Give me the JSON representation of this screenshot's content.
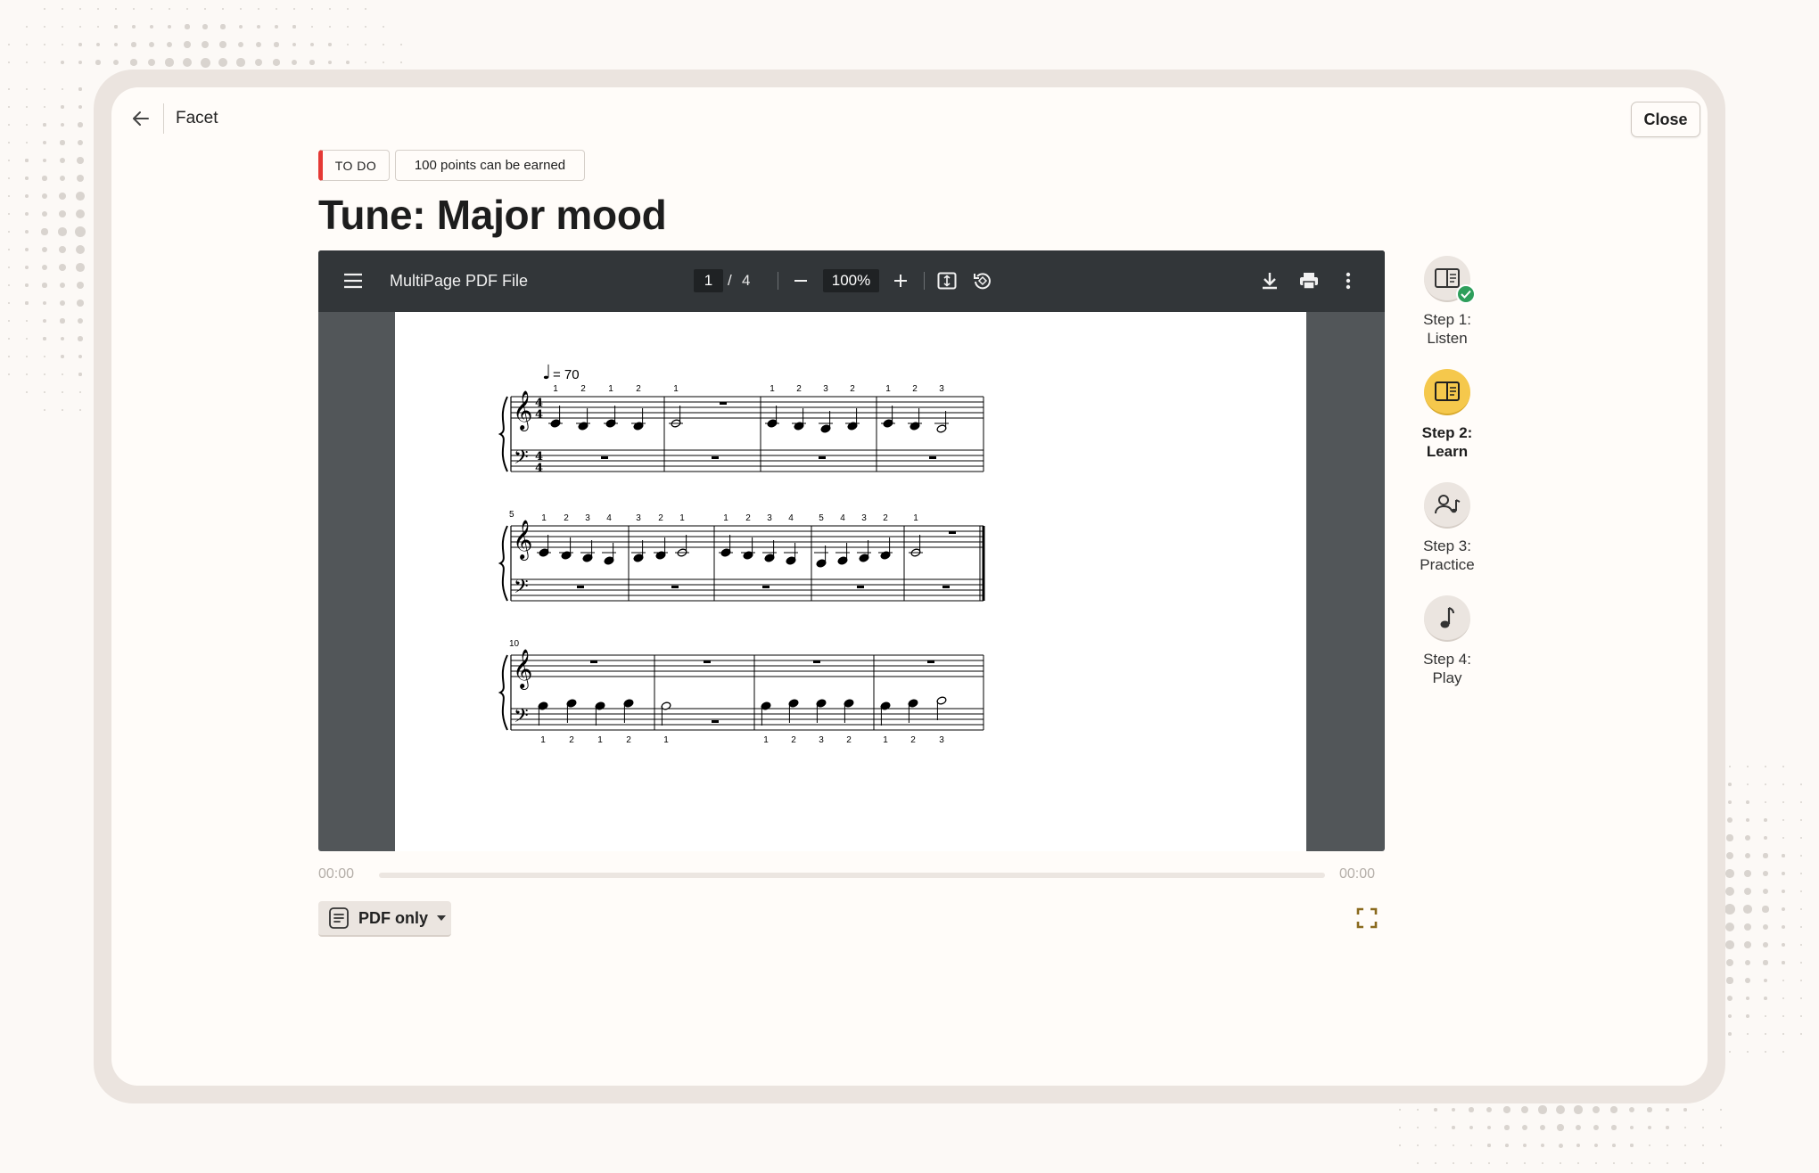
{
  "header": {
    "app_name": "Facet",
    "close_label": "Close"
  },
  "task": {
    "status_tag": "TO DO",
    "points_tag": "100 points can be earned",
    "title": "Tune: Major mood",
    "status_color": "#e53935"
  },
  "pdf_viewer": {
    "file_name": "MultiPage PDF File",
    "current_page": "1",
    "page_separator": "/",
    "total_pages": "4",
    "zoom": "100%",
    "icons": [
      "menu-icon",
      "zoom-out-icon",
      "zoom-in-icon",
      "fit-page-icon",
      "rotate-icon",
      "download-icon",
      "print-icon",
      "more-icon"
    ]
  },
  "sheet_music": {
    "tempo_value": "= 70",
    "systems": [
      {
        "measure_number": "",
        "treble_fingerings": [
          "1",
          "2",
          "1",
          "2",
          "1",
          "1",
          "2",
          "3",
          "2",
          "1",
          "2",
          "3"
        ],
        "bass_fingerings": []
      },
      {
        "measure_number": "5",
        "treble_fingerings": [
          "1",
          "2",
          "3",
          "4",
          "3",
          "2",
          "1",
          "1",
          "2",
          "3",
          "4",
          "5",
          "4",
          "3",
          "2",
          "1"
        ],
        "bass_fingerings": []
      },
      {
        "measure_number": "10",
        "treble_fingerings": [],
        "bass_fingerings": [
          "1",
          "2",
          "1",
          "2",
          "1",
          "1",
          "2",
          "3",
          "2",
          "1",
          "2",
          "3"
        ]
      }
    ]
  },
  "player": {
    "time_current": "00:00",
    "time_total": "00:00",
    "progress": 0,
    "accent_color": "#c9a64a"
  },
  "mode": {
    "selected": "PDF only"
  },
  "steps": [
    {
      "label_line1": "Step 1:",
      "label_line2": "Listen",
      "icon": "listen-book-icon",
      "completed": true,
      "active": false
    },
    {
      "label_line1": "Step 2:",
      "label_line2": "Learn",
      "icon": "learn-book-icon",
      "completed": false,
      "active": true
    },
    {
      "label_line1": "Step 3:",
      "label_line2": "Practice",
      "icon": "practice-person-music-icon",
      "completed": false,
      "active": false
    },
    {
      "label_line1": "Step 4:",
      "label_line2": "Play",
      "icon": "play-music-note-icon",
      "completed": false,
      "active": false
    }
  ]
}
